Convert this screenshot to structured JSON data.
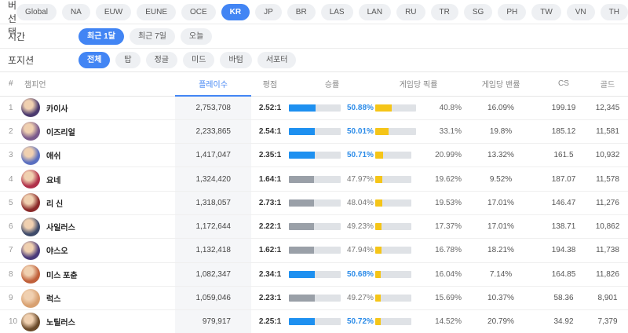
{
  "filters": {
    "server": {
      "label": "서버 선택",
      "options": [
        "Global",
        "NA",
        "EUW",
        "EUNE",
        "OCE",
        "KR",
        "JP",
        "BR",
        "LAS",
        "LAN",
        "RU",
        "TR",
        "SG",
        "PH",
        "TW",
        "VN",
        "TH"
      ],
      "selected": "KR"
    },
    "time": {
      "label": "시간",
      "options": [
        "최근 1달",
        "최근 7일",
        "오늘"
      ],
      "selected": "최근 1달"
    },
    "position": {
      "label": "포지션",
      "options": [
        "전체",
        "탑",
        "정글",
        "미드",
        "바텀",
        "서포터"
      ],
      "selected": "전체"
    }
  },
  "table": {
    "headers": {
      "rank": "#",
      "champion": "챔피언",
      "plays": "플레이수",
      "kda": "평점",
      "winrate": "승률",
      "pickrate": "게임당 픽률",
      "banrate": "게임당 밴률",
      "cs": "CS",
      "gold": "골드"
    },
    "sorted_column": "plays",
    "colors": {
      "win_high": "#1e90f0",
      "win_low": "#9aa0a8",
      "pick": "#f5c518",
      "track": "#dfe2e6"
    },
    "rows": [
      {
        "rank": "1",
        "name": "카이사",
        "plays": "2,753,708",
        "kda": "2.52:1",
        "winrate": 50.88,
        "winrate_text": "50.88%",
        "pickrate": 40.8,
        "pickrate_text": "40.8%",
        "banrate": "16.09%",
        "cs": "199.19",
        "gold": "12,345",
        "avatar_color": "#4b3a6e"
      },
      {
        "rank": "2",
        "name": "이즈리얼",
        "plays": "2,233,865",
        "kda": "2.54:1",
        "winrate": 50.01,
        "winrate_text": "50.01%",
        "pickrate": 33.1,
        "pickrate_text": "33.1%",
        "banrate": "19.8%",
        "cs": "185.12",
        "gold": "11,581",
        "avatar_color": "#7a5a8c"
      },
      {
        "rank": "3",
        "name": "애쉬",
        "plays": "1,417,047",
        "kda": "2.35:1",
        "winrate": 50.71,
        "winrate_text": "50.71%",
        "pickrate": 20.99,
        "pickrate_text": "20.99%",
        "banrate": "13.32%",
        "cs": "161.5",
        "gold": "10,932",
        "avatar_color": "#5a6fc0"
      },
      {
        "rank": "4",
        "name": "요네",
        "plays": "1,324,420",
        "kda": "1.64:1",
        "winrate": 47.97,
        "winrate_text": "47.97%",
        "pickrate": 19.62,
        "pickrate_text": "19.62%",
        "banrate": "9.52%",
        "cs": "187.07",
        "gold": "11,578",
        "avatar_color": "#b0304a"
      },
      {
        "rank": "5",
        "name": "리 신",
        "plays": "1,318,057",
        "kda": "2.73:1",
        "winrate": 48.04,
        "winrate_text": "48.04%",
        "pickrate": 19.53,
        "pickrate_text": "19.53%",
        "banrate": "17.01%",
        "cs": "146.47",
        "gold": "11,276",
        "avatar_color": "#8a2a2a"
      },
      {
        "rank": "6",
        "name": "사일러스",
        "plays": "1,172,644",
        "kda": "2.22:1",
        "winrate": 49.23,
        "winrate_text": "49.23%",
        "pickrate": 17.37,
        "pickrate_text": "17.37%",
        "banrate": "17.01%",
        "cs": "138.71",
        "gold": "10,862",
        "avatar_color": "#3e4a6a"
      },
      {
        "rank": "7",
        "name": "야스오",
        "plays": "1,132,418",
        "kda": "1.62:1",
        "winrate": 47.94,
        "winrate_text": "47.94%",
        "pickrate": 16.78,
        "pickrate_text": "16.78%",
        "banrate": "18.21%",
        "cs": "194.38",
        "gold": "11,738",
        "avatar_color": "#4a3a7a"
      },
      {
        "rank": "8",
        "name": "미스 포츈",
        "plays": "1,082,347",
        "kda": "2.34:1",
        "winrate": 50.68,
        "winrate_text": "50.68%",
        "pickrate": 16.04,
        "pickrate_text": "16.04%",
        "banrate": "7.14%",
        "cs": "164.85",
        "gold": "11,826",
        "avatar_color": "#c0603a"
      },
      {
        "rank": "9",
        "name": "럭스",
        "plays": "1,059,046",
        "kda": "2.23:1",
        "winrate": 49.27,
        "winrate_text": "49.27%",
        "pickrate": 15.69,
        "pickrate_text": "15.69%",
        "banrate": "10.37%",
        "cs": "58.36",
        "gold": "8,901",
        "avatar_color": "#d8a070"
      },
      {
        "rank": "10",
        "name": "노틸러스",
        "plays": "979,917",
        "kda": "2.25:1",
        "winrate": 50.72,
        "winrate_text": "50.72%",
        "pickrate": 14.52,
        "pickrate_text": "14.52%",
        "banrate": "20.79%",
        "cs": "34.92",
        "gold": "7,379",
        "avatar_color": "#6a4a2a"
      }
    ]
  }
}
